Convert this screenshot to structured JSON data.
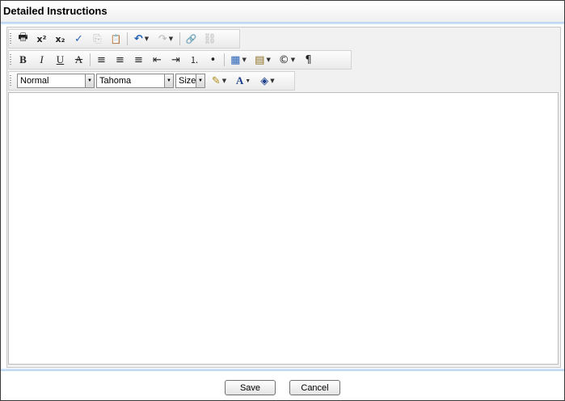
{
  "window": {
    "title": "Detailed Instructions"
  },
  "toolbar": {
    "row1": [
      {
        "name": "print-icon",
        "glyph": "🖶",
        "disabled": false
      },
      {
        "name": "superscript-icon",
        "glyph": "x²",
        "disabled": false
      },
      {
        "name": "subscript-icon",
        "glyph": "x₂",
        "disabled": false
      },
      {
        "name": "spellcheck-icon",
        "glyph": "✓",
        "disabled": false
      },
      {
        "name": "copy-icon",
        "glyph": "⎘",
        "disabled": true
      },
      {
        "name": "paste-icon",
        "glyph": "📋",
        "disabled": true
      },
      {
        "name": "undo-icon",
        "glyph": "↶",
        "disabled": false,
        "dropdown": true
      },
      {
        "name": "redo-icon",
        "glyph": "↷",
        "disabled": true,
        "dropdown": true
      },
      {
        "name": "insert-link-icon",
        "glyph": "🔗",
        "disabled": false
      },
      {
        "name": "remove-link-icon",
        "glyph": "⛓",
        "disabled": true
      }
    ],
    "row2": [
      {
        "name": "bold-icon",
        "glyph": "B",
        "disabled": false
      },
      {
        "name": "italic-icon",
        "glyph": "I",
        "disabled": false
      },
      {
        "name": "underline-icon",
        "glyph": "U",
        "disabled": false
      },
      {
        "name": "strikethrough-icon",
        "glyph": "A",
        "disabled": false
      },
      {
        "name": "align-left-icon",
        "glyph": "≡",
        "disabled": false
      },
      {
        "name": "align-center-icon",
        "glyph": "≡",
        "disabled": false
      },
      {
        "name": "align-right-icon",
        "glyph": "≡",
        "disabled": false
      },
      {
        "name": "outdent-icon",
        "glyph": "⇤",
        "disabled": false
      },
      {
        "name": "indent-icon",
        "glyph": "⇥",
        "disabled": false
      },
      {
        "name": "numbered-list-icon",
        "glyph": "⒈",
        "disabled": false
      },
      {
        "name": "bulleted-list-icon",
        "glyph": "•",
        "disabled": false
      },
      {
        "name": "table-icon",
        "glyph": "▦",
        "disabled": false,
        "dropdown": true
      },
      {
        "name": "form-element-icon",
        "glyph": "▤",
        "disabled": false,
        "dropdown": true
      },
      {
        "name": "special-character-icon",
        "glyph": "©",
        "disabled": false,
        "dropdown": true
      },
      {
        "name": "paragraph-icon",
        "glyph": "¶",
        "disabled": false
      }
    ],
    "paragraph_style": "Normal",
    "font_name": "Tahoma",
    "font_size": "Size",
    "row3_buttons": [
      {
        "name": "highlighter-icon",
        "glyph": "✎",
        "dropdown": true
      },
      {
        "name": "font-color-icon",
        "glyph": "A",
        "dropdown": true
      },
      {
        "name": "background-color-icon",
        "glyph": "◈",
        "dropdown": true
      }
    ]
  },
  "footer": {
    "save_label": "Save",
    "cancel_label": "Cancel"
  }
}
